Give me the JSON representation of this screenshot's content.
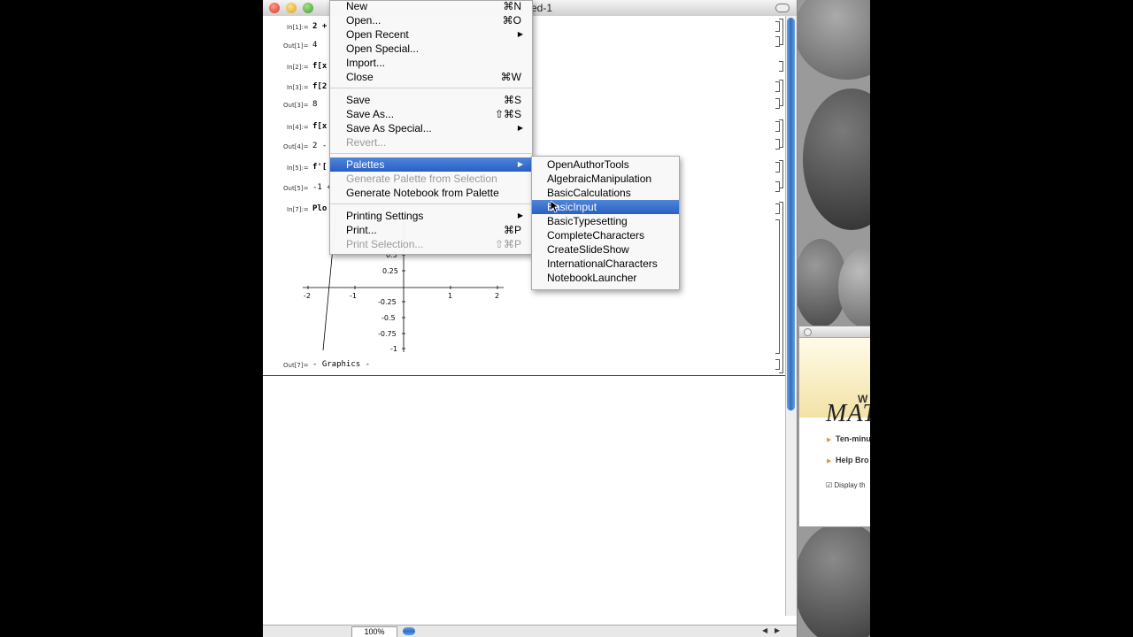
{
  "notebook": {
    "title": "ed-1",
    "zoom": "100%",
    "cells": [
      {
        "label": "In[1]:=",
        "code": "2 +"
      },
      {
        "label": "Out[1]=",
        "value": "4"
      },
      {
        "label": "In[2]:=",
        "code": "f[x"
      },
      {
        "label": "In[3]:=",
        "code": "f[2"
      },
      {
        "label": "Out[3]=",
        "value": "8"
      },
      {
        "label": "In[4]:=",
        "code": "f[x"
      },
      {
        "label": "Out[4]=",
        "value": "2 -"
      },
      {
        "label": "In[5]:=",
        "code": "f'["
      },
      {
        "label": "Out[5]=",
        "value": "-1 +"
      },
      {
        "label": "In[7]:=",
        "code": "Plo"
      },
      {
        "label": "Out[7]=",
        "value": "- Graphics -"
      }
    ],
    "plot_ticks": {
      "x": [
        "-2",
        "-1",
        "1",
        "2"
      ],
      "y": [
        "0.5",
        "0.25",
        "-0.25",
        "-0.5",
        "-0.75",
        "-1"
      ]
    }
  },
  "file_menu": {
    "items": [
      {
        "label": "New",
        "shortcut": "⌘N"
      },
      {
        "label": "Open...",
        "shortcut": "⌘O"
      },
      {
        "label": "Open Recent",
        "submenu": true
      },
      {
        "label": "Open Special..."
      },
      {
        "label": "Import..."
      },
      {
        "label": "Close",
        "shortcut": "⌘W"
      },
      {
        "label": "Save",
        "shortcut": "⌘S"
      },
      {
        "label": "Save As...",
        "shortcut": "⇧⌘S"
      },
      {
        "label": "Save As Special...",
        "submenu": true
      },
      {
        "label": "Revert...",
        "disabled": true
      },
      {
        "label": "Palettes",
        "submenu": true,
        "highlighted": true
      },
      {
        "label": "Generate Palette from Selection",
        "disabled": true
      },
      {
        "label": "Generate Notebook from Palette"
      },
      {
        "label": "Printing Settings",
        "submenu": true
      },
      {
        "label": "Print...",
        "shortcut": "⌘P"
      },
      {
        "label": "Print Selection...",
        "shortcut": "⇧⌘P",
        "disabled": true
      }
    ]
  },
  "palettes_submenu": {
    "items": [
      "OpenAuthorTools",
      "AlgebraicManipulation",
      "BasicCalculations",
      "BasicInput",
      "BasicTypesetting",
      "CompleteCharacters",
      "CreateSlideShow",
      "InternationalCharacters",
      "NotebookLauncher"
    ],
    "highlighted_index": 3
  },
  "welcome": {
    "small_text": "W",
    "big_text": "MAT",
    "links": [
      "Ten-minu",
      "Help Bro"
    ],
    "checkbox": "Display th"
  },
  "colors": {
    "highlight": "#2a5fc4",
    "scroll_thumb": "#2e6fc6"
  }
}
